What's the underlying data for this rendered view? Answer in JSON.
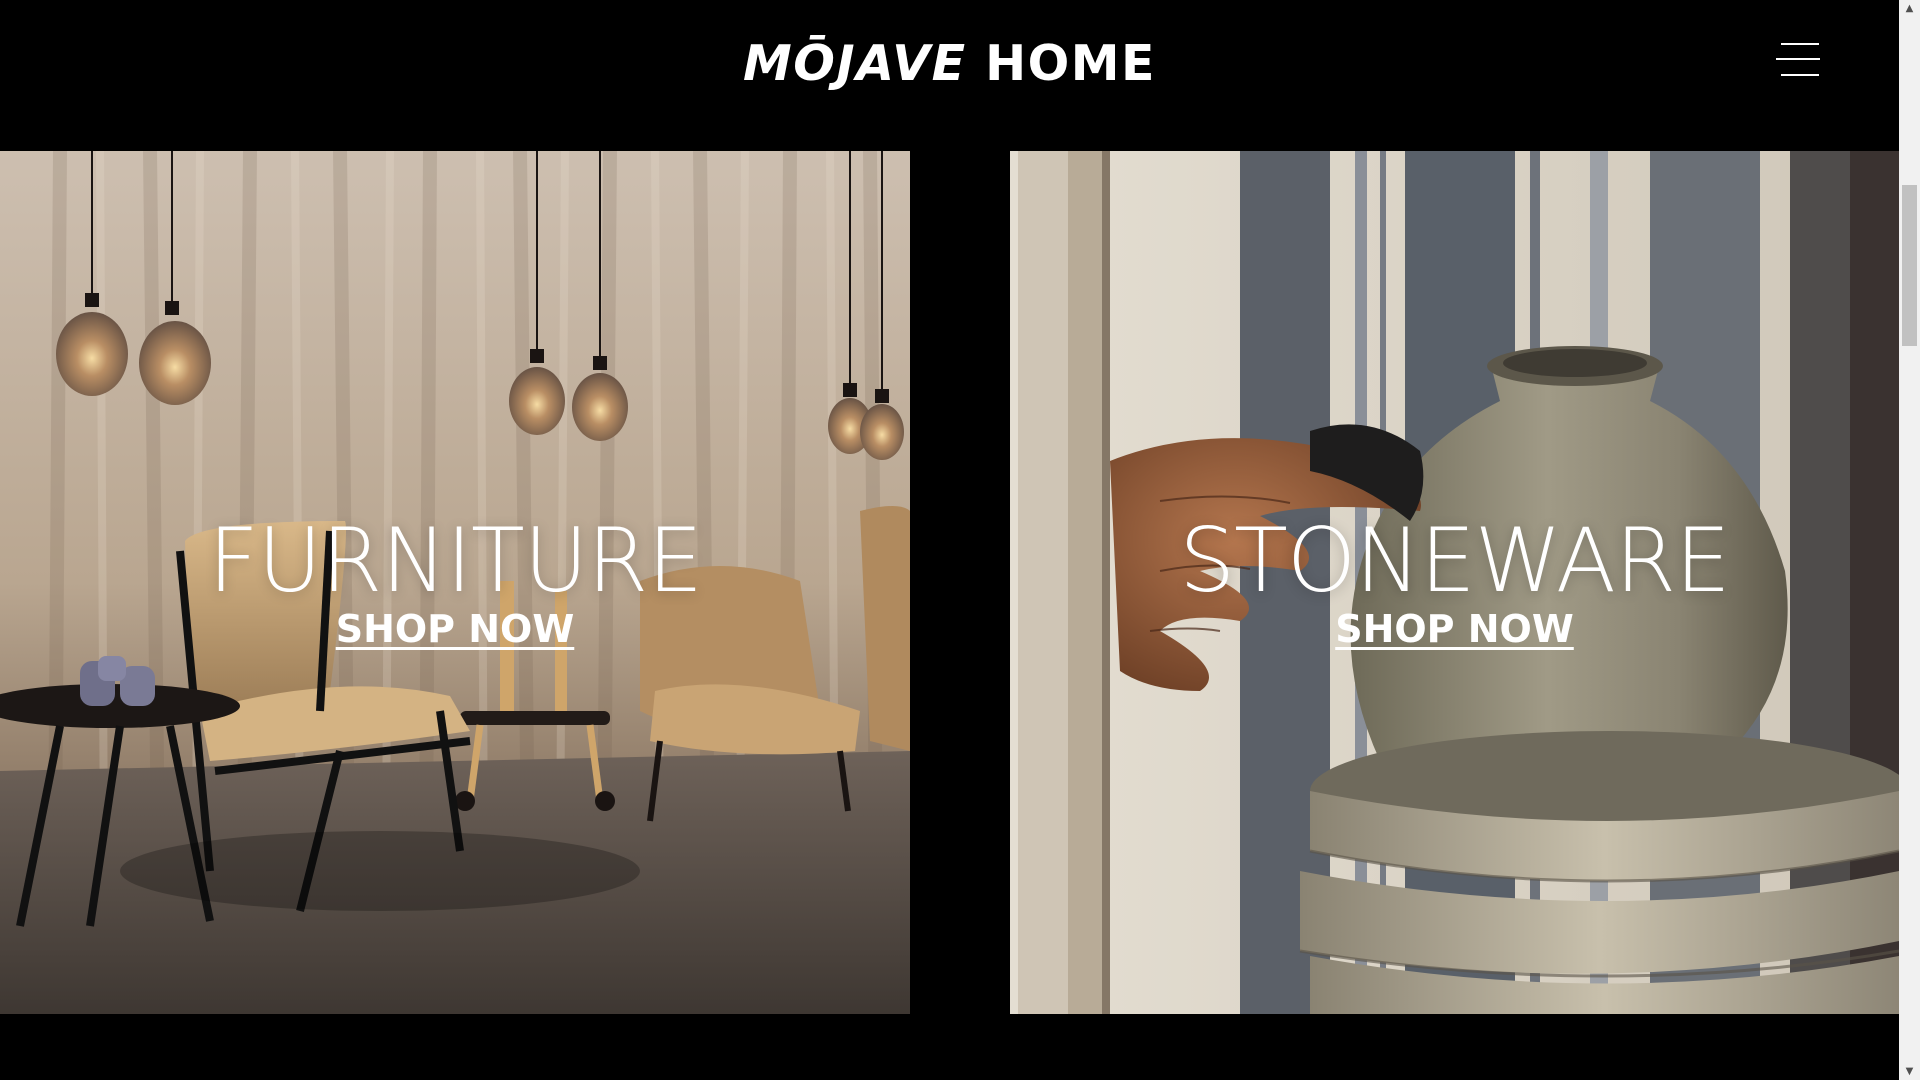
{
  "brand": {
    "name_italic": "MŌJAVE",
    "name_regular": " HOME"
  },
  "header": {
    "menu_icon": "hamburger-menu-icon"
  },
  "categories": [
    {
      "title": "FURNITURE",
      "link_label": "SHOP NOW",
      "image": "furniture-showroom-photo"
    },
    {
      "title": "STONEWARE",
      "link_label": "SHOP NOW",
      "image": "pottery-wheel-photo"
    }
  ],
  "scrollbar": {
    "up_glyph": "▲",
    "down_glyph": "▼"
  },
  "colors": {
    "background": "#000000",
    "text": "#ffffff"
  }
}
